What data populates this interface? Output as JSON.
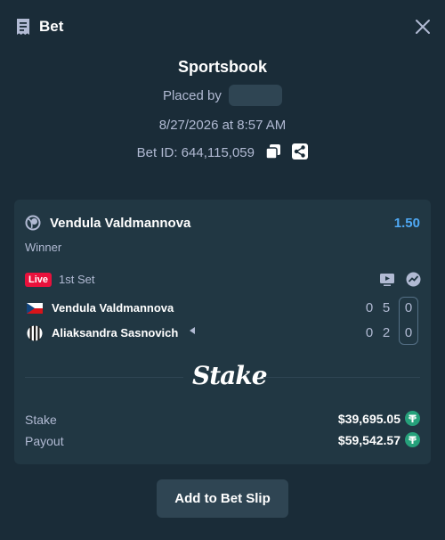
{
  "header": {
    "title": "Bet"
  },
  "summary": {
    "title": "Sportsbook",
    "placed_by_label": "Placed by",
    "datetime": "8/27/2026 at 8:57 AM",
    "bet_id": "Bet ID: 644,115,059"
  },
  "selection": {
    "name": "Vendula Valdmannova",
    "odds": "1.50",
    "market": "Winner",
    "live_badge": "Live",
    "period": "1st Set"
  },
  "players": [
    {
      "name": "Vendula Valdmannova",
      "games": "0",
      "set": "5",
      "points": "0",
      "flag": "czech"
    },
    {
      "name": "Aliaksandra Sasnovich",
      "games": "0",
      "set": "2",
      "points": "0",
      "flag": "neutral",
      "serving": true
    }
  ],
  "brand": {
    "logo_text": "Stake"
  },
  "amounts": {
    "stake_label": "Stake",
    "stake_value": "$39,695.05",
    "payout_label": "Payout",
    "payout_value": "$59,542.57"
  },
  "actions": {
    "add_to_slip": "Add to Bet Slip"
  },
  "colors": {
    "background": "#1a2c38",
    "card": "#213743",
    "muted_text": "#b1bad3",
    "odds": "#4fa9f5",
    "live": "#e9113c",
    "tether": "#26a17b",
    "button": "#2f4553"
  }
}
